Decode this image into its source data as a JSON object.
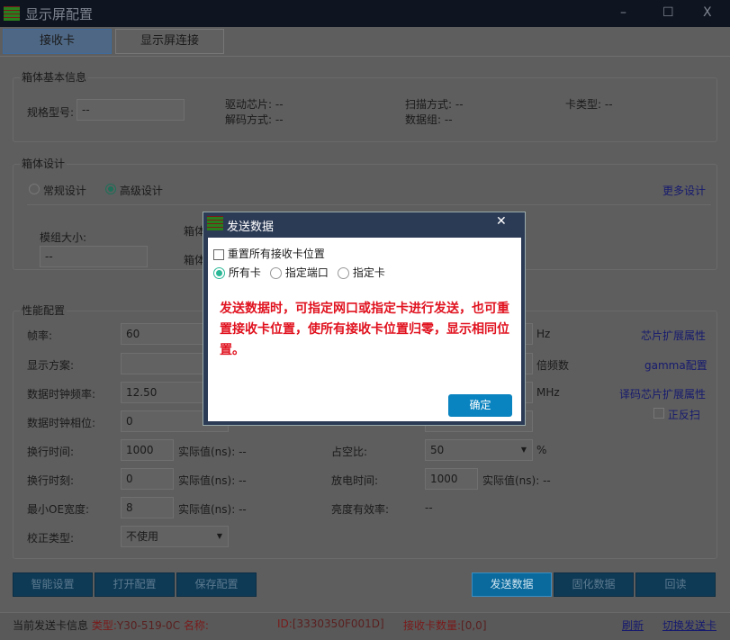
{
  "window": {
    "title": "显示屏配置",
    "min": "–",
    "max": "☐",
    "close": "X"
  },
  "tabs": [
    {
      "label": "接收卡",
      "active": true
    },
    {
      "label": "显示屏连接",
      "active": false
    }
  ],
  "basic": {
    "title": "箱体基本信息",
    "model_label": "规格型号:",
    "model_value": "--",
    "chip": "驱动芯片: --",
    "decode": "解码方式: --",
    "scan": "扫描方式: --",
    "datagroup": "数据组: --",
    "cardtype": "卡类型: --"
  },
  "design": {
    "title": "箱体设计",
    "normal": "常规设计",
    "advanced": "高级设计",
    "selected": "高级设计",
    "more": "更多设计",
    "module_label": "模组大小:",
    "module_value": "--",
    "box1": "箱体",
    "box2": "箱体"
  },
  "perf": {
    "title": "性能配置",
    "frame_label": "帧率:",
    "frame_value": "60",
    "hz": "Hz",
    "chip_ext": "芯片扩展属性",
    "scheme_label": "显示方案:",
    "scheme_value": "",
    "multiplier": "倍频数",
    "gamma": "gamma配置",
    "clock_label": "数据时钟频率:",
    "clock_value": "12.50",
    "mhz": "MHz",
    "decode_ext": "译码芯片扩展属性",
    "phase_label": "数据时钟相位:",
    "phase_value": "0",
    "reverse": "正反扫",
    "lt_label": "换行时间:",
    "lt_value": "1000",
    "lt_actual": "实际值(ns): --",
    "duty_label": "占空比:",
    "duty_value": "50",
    "percent": "%",
    "lm_label": "换行时刻:",
    "lm_value": "0",
    "lm_actual": "实际值(ns): --",
    "dis_label": "放电时间:",
    "dis_value": "1000",
    "dis_actual": "实际值(ns): --",
    "oe_label": "最小OE宽度:",
    "oe_value": "8",
    "oe_actual": "实际值(ns): --",
    "eff_label": "亮度有效率:",
    "eff_value": "--",
    "corr_label": "校正类型:",
    "corr_value": "不使用"
  },
  "buttons": {
    "smart": "智能设置",
    "open": "打开配置",
    "save": "保存配置",
    "send": "发送数据",
    "solid": "固化数据",
    "read": "回读"
  },
  "status": {
    "info": "当前发送卡信息",
    "type": "类型:",
    "type_value": "Y30-519-0C",
    "name": "名称:",
    "id": "ID:",
    "id_value": "[3330350F001D]",
    "count": "接收卡数量:",
    "count_value": "[0,0]",
    "refresh": "刷新",
    "switch": "切换发送卡"
  },
  "dialog": {
    "title": "发送数据",
    "close": "✕",
    "reset_label": "重置所有接收卡位置",
    "reset_checked": false,
    "options": [
      "所有卡",
      "指定端口",
      "指定卡"
    ],
    "selected": "所有卡",
    "message": "发送数据时，可指定网口或指定卡进行发送，也可重置接收卡位置，使所有接收卡位置归零，显示相同位置。",
    "ok": "确定",
    "message_color": "#e0121f",
    "ok_color": "#0a84c0"
  }
}
